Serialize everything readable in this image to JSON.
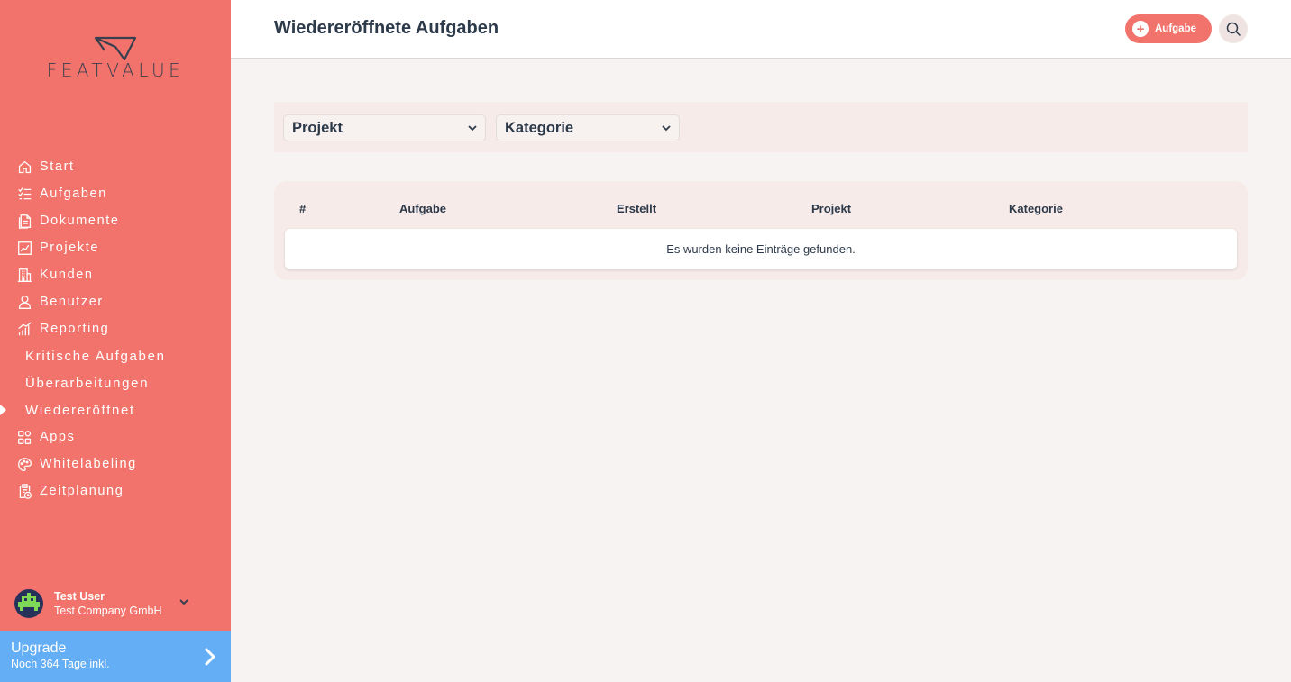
{
  "brand": {
    "logo_text": "FEATVALUE"
  },
  "sidebar": {
    "items": [
      {
        "label": "Start",
        "icon": "home-icon"
      },
      {
        "label": "Aufgaben",
        "icon": "tasks-icon"
      },
      {
        "label": "Dokumente",
        "icon": "documents-icon"
      },
      {
        "label": "Projekte",
        "icon": "projects-icon"
      },
      {
        "label": "Kunden",
        "icon": "building-icon"
      },
      {
        "label": "Benutzer",
        "icon": "user-icon"
      },
      {
        "label": "Reporting",
        "icon": "reporting-icon"
      }
    ],
    "subitems": [
      {
        "label": "Kritische Aufgaben"
      },
      {
        "label": "Überarbeitungen"
      },
      {
        "label": "Wiedereröffnet",
        "active": true
      }
    ],
    "items2": [
      {
        "label": "Apps",
        "icon": "apps-icon"
      },
      {
        "label": "Whitelabeling",
        "icon": "palette-icon"
      },
      {
        "label": "Zeitplanung",
        "icon": "clipboard-clock-icon"
      }
    ],
    "user": {
      "name": "Test User",
      "company": "Test Company GmbH"
    },
    "upgrade": {
      "title": "Upgrade",
      "subtitle": "Noch 364 Tage inkl."
    }
  },
  "header": {
    "title": "Wiedereröffnete Aufgaben",
    "add_button_label": "Aufgabe"
  },
  "filters": {
    "project_select": "Projekt",
    "category_select": "Kategorie"
  },
  "table": {
    "columns": [
      "#",
      "Aufgabe",
      "Erstellt",
      "Projekt",
      "Kategorie"
    ],
    "empty_message": "Es wurden keine Einträge gefunden."
  },
  "colors": {
    "sidebar": "#f2736b",
    "upgrade": "#64aef5",
    "text": "#2d3a4a",
    "background": "#f7f3f2"
  }
}
